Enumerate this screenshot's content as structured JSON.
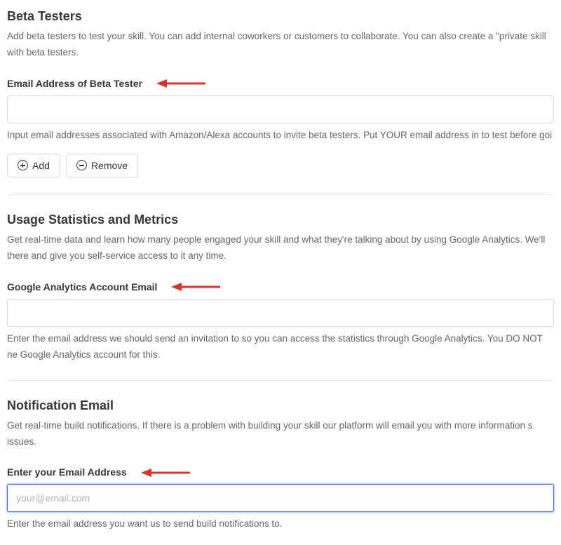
{
  "sections": {
    "beta": {
      "heading": "Beta Testers",
      "description": "Add beta testers to test your skill. You can add internal coworkers or customers to collaborate. You can also create a \"private skill with beta testers.",
      "field": {
        "label": "Email Address of Beta Tester",
        "value": "",
        "help": "Input email addresses associated with Amazon/Alexa accounts to invite beta testers. Put YOUR email address in to test before goi"
      },
      "buttons": {
        "add": "Add",
        "remove": "Remove"
      }
    },
    "metrics": {
      "heading": "Usage Statistics and Metrics",
      "description": "Get real-time data and learn how many people engaged your skill and what they're talking about by using Google Analytics. We'll there and give you self-service access to it any time.",
      "field": {
        "label": "Google Analytics Account Email",
        "value": "",
        "help": "Enter the email address we should send an invitation to so you can access the statistics through Google Analytics. You DO NOT ne Google Analytics account for this."
      }
    },
    "notification": {
      "heading": "Notification Email",
      "description": "Get real-time build notifications. If there is a problem with building your skill our platform will email you with more information s issues.",
      "field": {
        "label": "Enter your Email Address",
        "placeholder": "your@email.com",
        "value": "",
        "help": "Enter the email address you want us to send build notifications to."
      }
    }
  },
  "annotation": {
    "arrow_color": "#d9342b"
  }
}
